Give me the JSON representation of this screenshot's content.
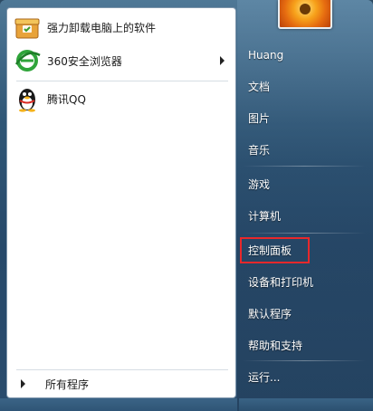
{
  "programs": [
    {
      "label": "强力卸载电脑上的软件",
      "icon": "uninstaller-box-icon"
    },
    {
      "label": "360安全浏览器",
      "icon": "360-browser-icon",
      "has_submenu": true
    },
    {
      "label": "腾讯QQ",
      "icon": "qq-penguin-icon"
    }
  ],
  "all_programs_label": "所有程序",
  "right_pane": {
    "items": [
      {
        "label": "Huang"
      },
      {
        "label": "文档"
      },
      {
        "label": "图片"
      },
      {
        "label": "音乐"
      },
      {
        "label": "游戏"
      },
      {
        "label": "计算机"
      },
      {
        "label": "控制面板",
        "highlighted": true
      },
      {
        "label": "设备和打印机"
      },
      {
        "label": "默认程序"
      },
      {
        "label": "帮助和支持"
      },
      {
        "label": "运行..."
      }
    ]
  },
  "colors": {
    "highlight_border": "#e8282b",
    "menu_glass": "#2f5676"
  }
}
